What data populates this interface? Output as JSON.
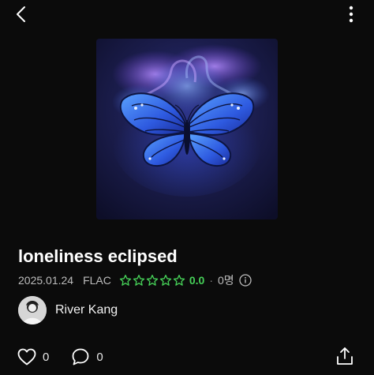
{
  "header": {
    "back_icon": "chevron-left-icon",
    "more_icon": "vertical-ellipsis-icon"
  },
  "track": {
    "title": "loneliness eclipsed",
    "date": "2025.01.24",
    "format": "FLAC",
    "stars_filled": 0,
    "stars_total": 5,
    "rating": "0.0",
    "separator": "·",
    "rating_count": "0명",
    "info_icon": "info-icon"
  },
  "artist": {
    "name": "River Kang",
    "avatar_icon": "avatar-image"
  },
  "actions": {
    "like_count": "0",
    "comment_count": "0",
    "like_icon": "heart-icon",
    "comment_icon": "comment-bubble-icon",
    "share_icon": "share-upload-icon"
  },
  "colors": {
    "background": "#0b0b0b",
    "rating_green": "#46d158",
    "meta_gray": "#bdbdbd"
  }
}
